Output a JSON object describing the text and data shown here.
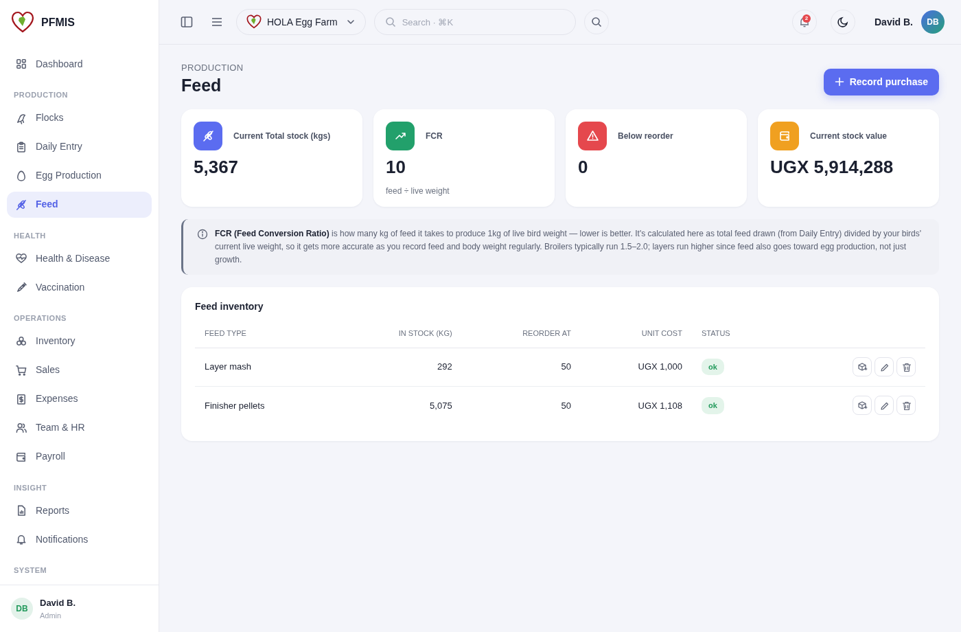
{
  "brand": {
    "name": "PFMIS"
  },
  "sidebar": {
    "sections": [
      {
        "items": [
          {
            "label": "Dashboard",
            "selected": false
          }
        ]
      },
      {
        "title": "PRODUCTION",
        "items": [
          {
            "label": "Flocks",
            "selected": false
          },
          {
            "label": "Daily Entry",
            "selected": false
          },
          {
            "label": "Egg Production",
            "selected": false
          },
          {
            "label": "Feed",
            "selected": true
          }
        ]
      },
      {
        "title": "HEALTH",
        "items": [
          {
            "label": "Health & Disease",
            "selected": false
          },
          {
            "label": "Vaccination",
            "selected": false
          }
        ]
      },
      {
        "title": "OPERATIONS",
        "items": [
          {
            "label": "Inventory",
            "selected": false
          },
          {
            "label": "Sales",
            "selected": false
          },
          {
            "label": "Expenses",
            "selected": false
          },
          {
            "label": "Team & HR",
            "selected": false
          },
          {
            "label": "Payroll",
            "selected": false
          }
        ]
      },
      {
        "title": "INSIGHT",
        "items": [
          {
            "label": "Reports",
            "selected": false
          },
          {
            "label": "Notifications",
            "selected": false
          }
        ]
      },
      {
        "title": "SYSTEM"
      }
    ],
    "user": {
      "initials": "DB",
      "name": "David B.",
      "role": "Admin"
    }
  },
  "header": {
    "farm": "HOLA Egg Farm",
    "search": {
      "placeholder": "Search · ⌘K"
    },
    "notification_count": "2",
    "user": {
      "name": "David B.",
      "initials": "DB"
    }
  },
  "page": {
    "eyebrow": "PRODUCTION",
    "title": "Feed",
    "action": "Record purchase"
  },
  "stats": [
    {
      "label": "Current Total stock (kgs)",
      "value": "5,367",
      "color": "#5b6cf0"
    },
    {
      "label": "FCR",
      "value": "10",
      "note": "feed ÷ live weight",
      "color": "#22a06b"
    },
    {
      "label": "Below reorder",
      "value": "0",
      "color": "#e5484d"
    },
    {
      "label": "Current stock value",
      "value": "UGX 5,914,288",
      "color": "#f0a020"
    }
  ],
  "info": "**FCR (Feed Conversion Ratio)** is how many kg of feed it takes to produce 1kg of live bird weight — lower is better. It's calculated here as total feed drawn (from Daily Entry) divided by your birds' current live weight, so it gets more accurate as you record feed and body weight regularly. Broilers typically run 1.5–2.0; layers run higher since feed also goes toward egg production, not just growth.",
  "inventory": {
    "title": "Feed inventory",
    "columns": [
      "FEED TYPE",
      "IN STOCK (KG)",
      "REORDER AT",
      "UNIT COST",
      "STATUS"
    ],
    "rows": [
      {
        "feed_type": "Layer mash",
        "in_stock": "292",
        "reorder_at": "50",
        "unit_cost": "UGX 1,000",
        "status": "ok"
      },
      {
        "feed_type": "Finisher pellets",
        "in_stock": "5,075",
        "reorder_at": "50",
        "unit_cost": "UGX 1,108",
        "status": "ok"
      }
    ]
  }
}
